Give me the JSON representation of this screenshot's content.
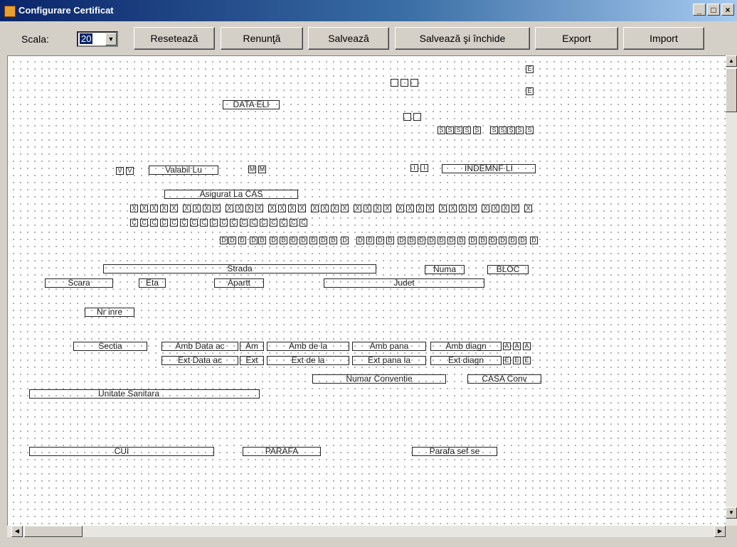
{
  "window": {
    "title": "Configurare Certificat",
    "controls": {
      "minimize": "_",
      "maximize": "□",
      "close": "×"
    }
  },
  "toolbar": {
    "scale_label": "Scala:",
    "scale_value": "20",
    "buttons": {
      "reset": "Resetează",
      "cancel": "Renunţă",
      "save": "Salvează",
      "save_close": "Salvează şi închide",
      "export": "Export",
      "import": "Import"
    }
  },
  "fields": {
    "data_eli": "DATA ELI",
    "valabil_lu": "Valabil Lu",
    "indemn": "INDEMNF LI",
    "asigurat": "Asigurat La CAS",
    "strada": "Strada",
    "numa": "Numa",
    "bloc": "BLOC",
    "scara": "Scara",
    "etaj": "Eta",
    "apart": "Apartt",
    "judet": "Judet",
    "nr_inre": "Nr inre",
    "sectia": "Sectia",
    "amb_data": "Amb Data ac",
    "amb_short": "Am",
    "amb_de_la": "Amb de la",
    "amb_pana": "Amb pana",
    "amb_diagn": "Amb diagn",
    "ext_data": "Ext Data ac",
    "ext_short": "Ext",
    "ext_de_la": "Ext de la",
    "ext_pana": "Ext pana la",
    "ext_diagn": "Ext diagn",
    "numar_conv": "Numar Conventie",
    "casa_conv": "CASA Conv",
    "unitate": "Unitate Sanitara",
    "cui": "CUI",
    "parafa": "PARAFA",
    "parafa_sef": "Parafa sef se",
    "e": "E",
    "a": "A",
    "d": "D",
    "v": "V",
    "m": "M",
    "s": "S",
    "x": "X",
    "c": "C",
    "i": "I"
  },
  "scrollbars": {
    "up": "▲",
    "down": "▼",
    "left": "◀",
    "right": "▶"
  }
}
